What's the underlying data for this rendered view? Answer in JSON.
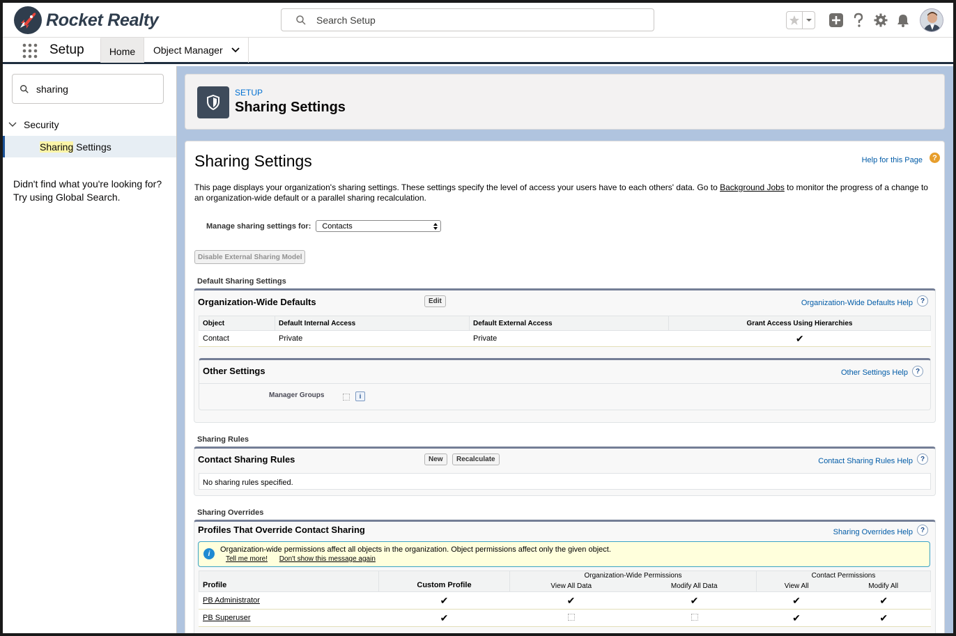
{
  "brand": {
    "name": "Rocket Realty"
  },
  "search": {
    "placeholder": "Search Setup"
  },
  "nav": {
    "app_name": "Setup",
    "tabs": [
      {
        "label": "Home"
      },
      {
        "label": "Object Manager"
      }
    ]
  },
  "sidebar": {
    "quick_find_value": "sharing",
    "tree_parent": "Security",
    "tree_item_highlight": "Sharing",
    "tree_item_rest": " Settings",
    "not_found": "Didn't find what you're looking for? Try using Global Search."
  },
  "header": {
    "eyebrow": "SETUP",
    "title": "Sharing Settings"
  },
  "content": {
    "title": "Sharing Settings",
    "help_link": "Help for this Page",
    "description_pre": "This page displays your organization's sharing settings. These settings specify the level of access your users have to each others' data. Go to ",
    "description_link": "Background Jobs",
    "description_post": " to monitor the progress of a change to an organization-wide default or a parallel sharing recalculation.",
    "manage_label": "Manage sharing settings for:",
    "manage_value": "Contacts",
    "disable_button": "Disable External Sharing Model"
  },
  "default_sharing": {
    "section_label": "Default Sharing Settings",
    "title": "Organization-Wide Defaults",
    "edit_button": "Edit",
    "help": "Organization-Wide Defaults Help",
    "columns": [
      "Object",
      "Default Internal Access",
      "Default External Access",
      "Grant Access Using Hierarchies"
    ],
    "rows": [
      {
        "object": "Contact",
        "internal": "Private",
        "external": "Private",
        "hierarchies": true
      }
    ],
    "other_settings": {
      "title": "Other Settings",
      "help": "Other Settings Help",
      "manager_groups_label": "Manager Groups"
    }
  },
  "sharing_rules": {
    "section_label": "Sharing Rules",
    "title": "Contact Sharing Rules",
    "new_button": "New",
    "recalc_button": "Recalculate",
    "help": "Contact Sharing Rules Help",
    "empty": "No sharing rules specified."
  },
  "overrides": {
    "section_label": "Sharing Overrides",
    "title": "Profiles That Override Contact Sharing",
    "help": "Sharing Overrides Help",
    "info_message": "Organization-wide permissions affect all objects in the organization. Object permissions affect only the given object.",
    "tell_me_more": "Tell me more!",
    "dont_show": "Don't show this message again",
    "group_headers": {
      "org_wide": "Organization-Wide Permissions",
      "contact": "Contact Permissions"
    },
    "columns": {
      "profile": "Profile",
      "custom": "Custom Profile",
      "view_all_data": "View All Data",
      "modify_all_data": "Modify All Data",
      "view_all": "View All",
      "modify_all": "Modify All"
    },
    "rows": [
      {
        "profile": "PB Administrator",
        "custom": true,
        "view_all_data": true,
        "modify_all_data": true,
        "view_all": true,
        "modify_all": true
      },
      {
        "profile": "PB Superuser",
        "custom": true,
        "view_all_data": false,
        "modify_all_data": false,
        "view_all": true,
        "modify_all": true
      }
    ]
  },
  "colors": {
    "brand_dark": "#2f3d4d",
    "accent_red": "#e8443a",
    "main_bg": "#b0c4df",
    "link": "#015ba7"
  }
}
